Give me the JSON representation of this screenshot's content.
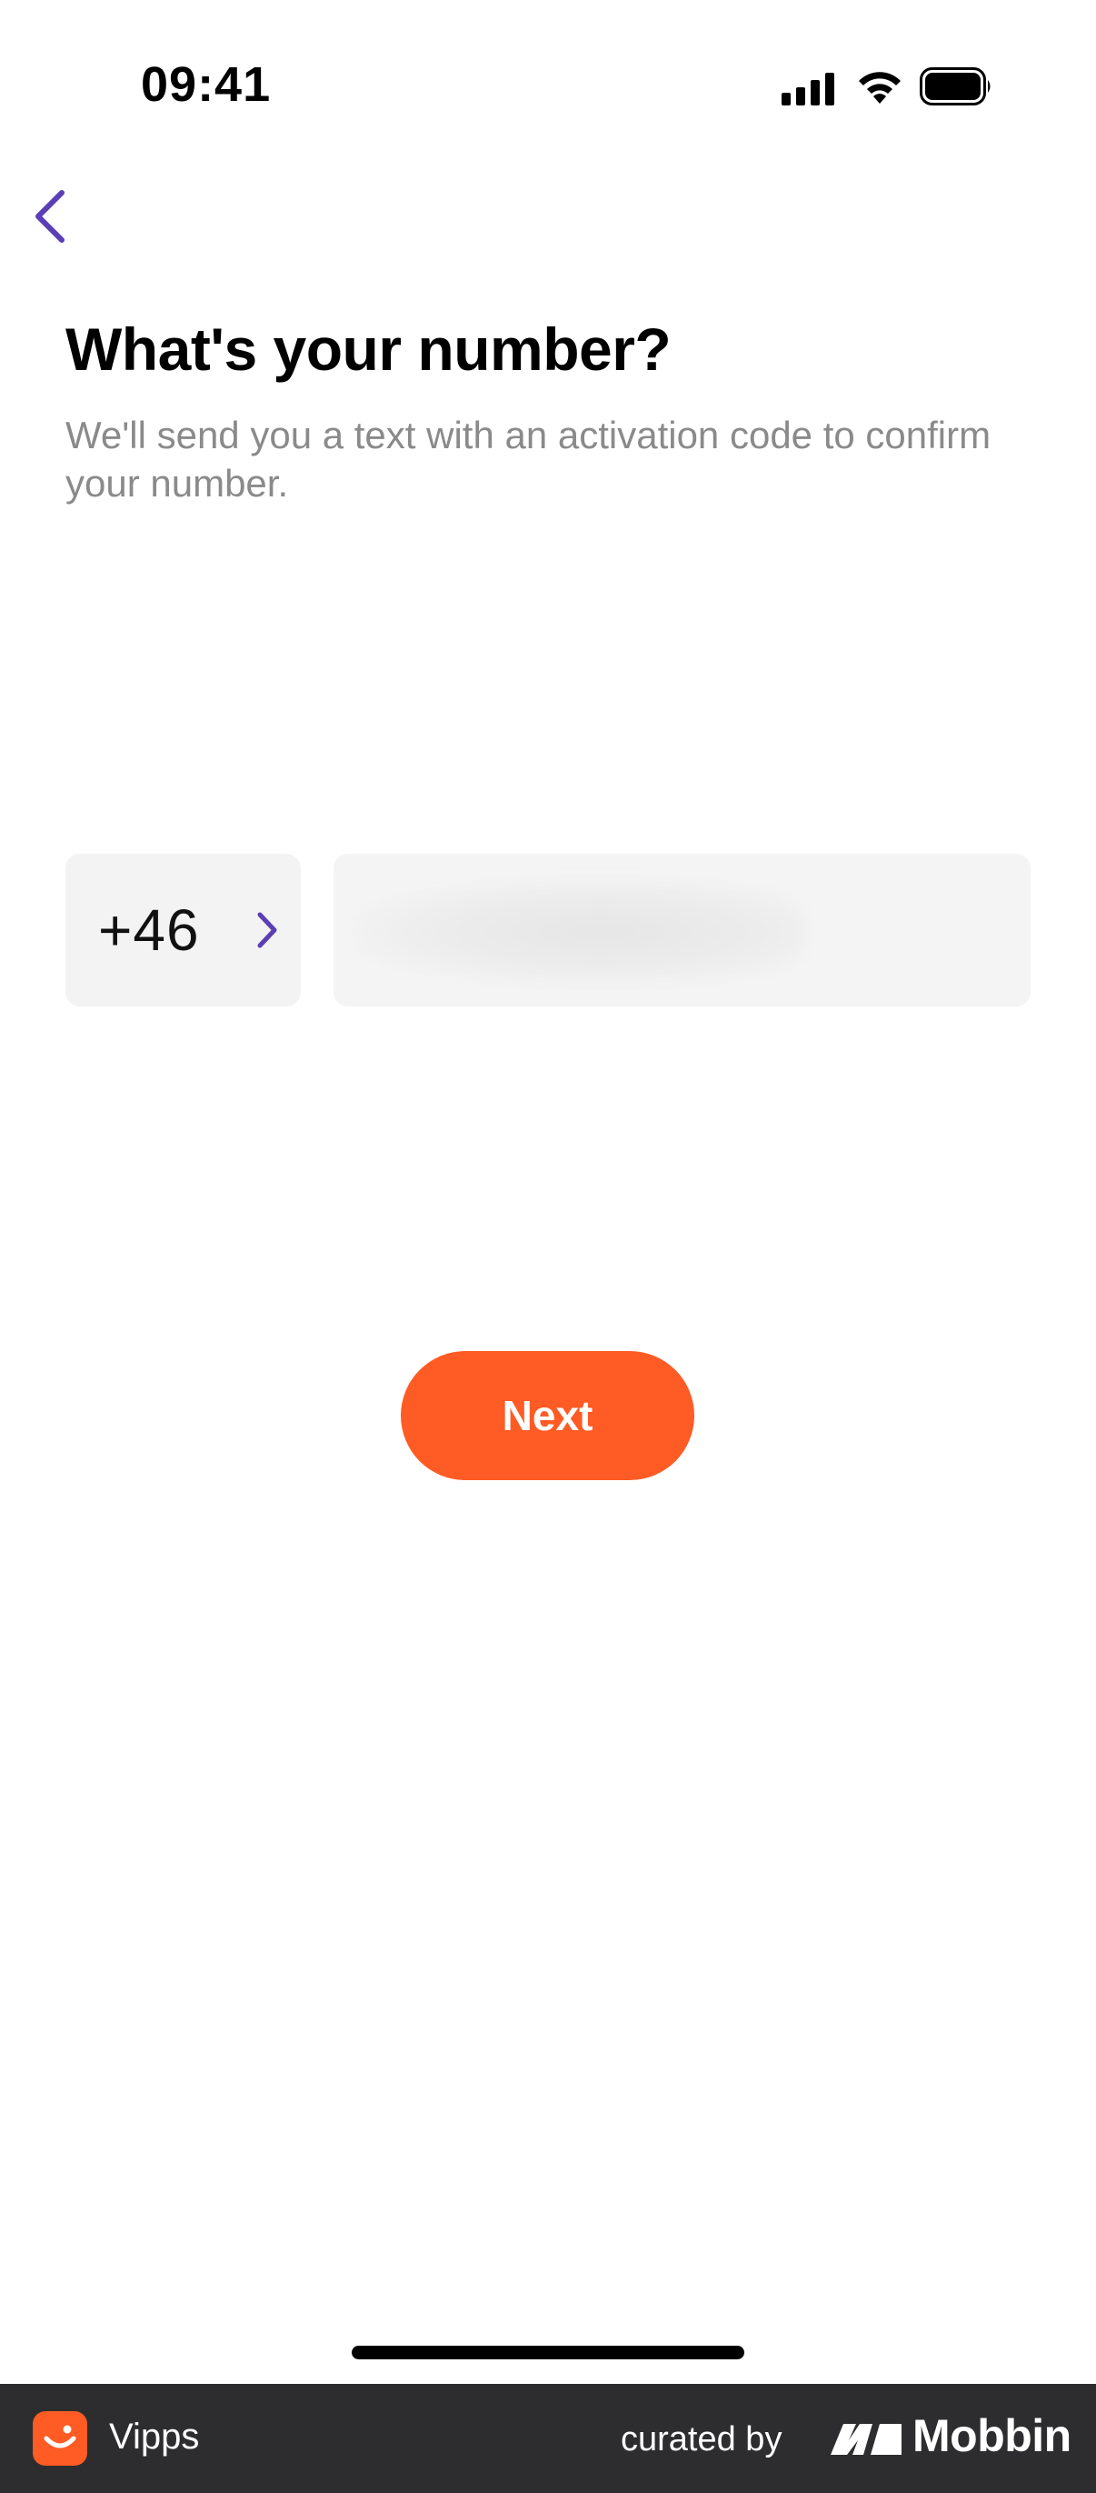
{
  "status_bar": {
    "time": "09:41",
    "icons": [
      "cellular-signal-icon",
      "wifi-icon",
      "battery-icon"
    ]
  },
  "header": {
    "back_icon": "chevron-left-icon"
  },
  "content": {
    "title": "What's your number?",
    "subtitle": "We'll send you a text with an activation code to confirm your number."
  },
  "phone": {
    "country_code": "+46",
    "country_chevron_icon": "chevron-right-icon",
    "number_value": "",
    "number_placeholder": ""
  },
  "actions": {
    "next_label": "Next"
  },
  "footer": {
    "app_name": "Vipps",
    "curated_by": "curated by",
    "brand": "Mobbin"
  },
  "colors": {
    "accent_purple": "#5a3fb5",
    "primary_orange": "#ff5b24",
    "footer_bg": "#2d2d2f",
    "subtitle_gray": "#8a8a8a",
    "field_bg": "#f3f3f3"
  }
}
